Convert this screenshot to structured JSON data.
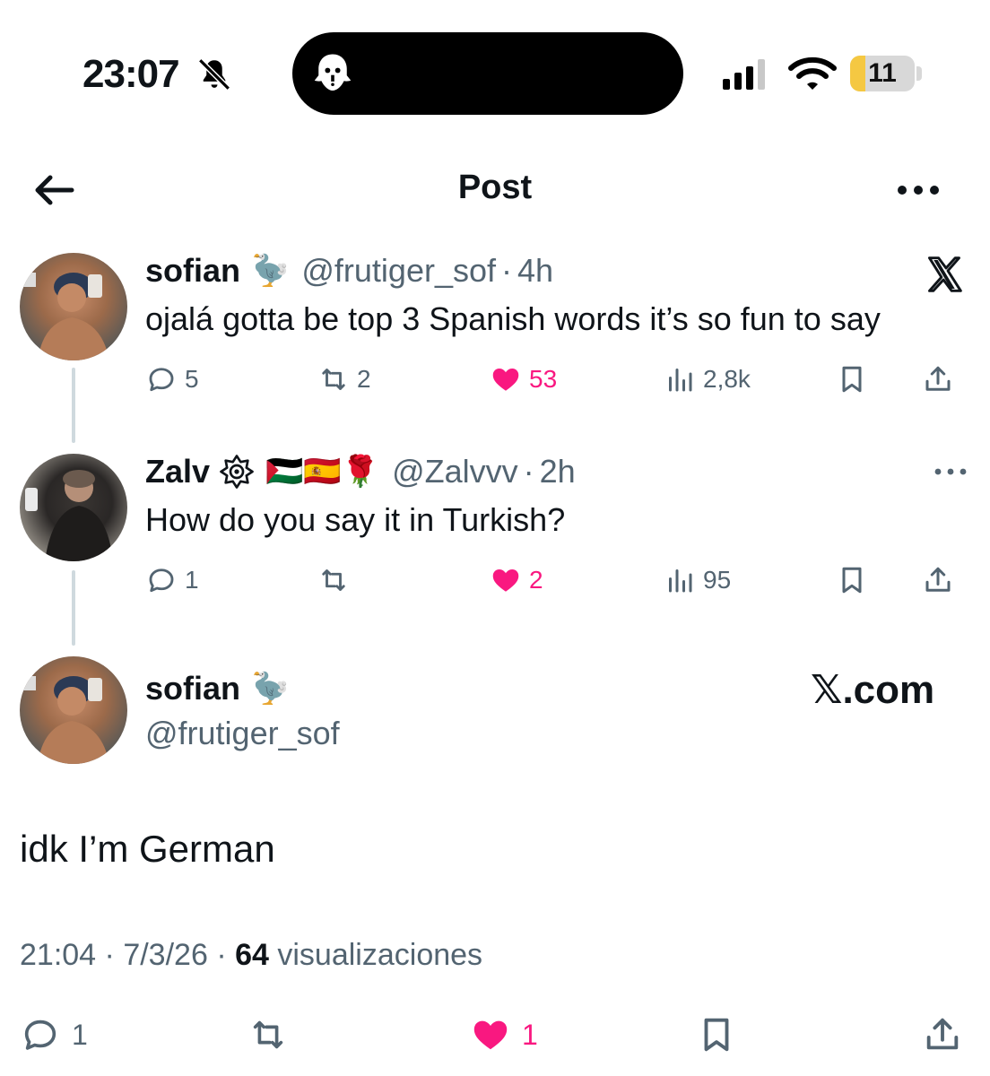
{
  "status_bar": {
    "time": "23:07",
    "battery_level": "11",
    "battery_fraction": 0.11
  },
  "header": {
    "title": "Post"
  },
  "colors": {
    "like": "#f91880",
    "secondary_text": "#536471",
    "primary_text": "#0f1419",
    "battery": "#f5c842"
  },
  "tweets": [
    {
      "name": "sofian",
      "emoji": "🦤",
      "handle": "@frutiger_sof",
      "sep": "·",
      "time": "4h",
      "text": "ojalá gotta be top 3 Spanish words it’s so fun to say",
      "replies": "5",
      "reposts": "2",
      "likes": "53",
      "views": "2,8k"
    },
    {
      "name": "Zalv",
      "emoji": "🇵🇸🇪🇸🌹",
      "handle": "@Zalvvv",
      "sep": "·",
      "time": "2h",
      "text": "How do you say it in Turkish?",
      "replies": "1",
      "reposts": "",
      "likes": "2",
      "views": "95"
    }
  ],
  "main_post": {
    "name": "sofian",
    "emoji": "🦤",
    "handle": "@frutiger_sof",
    "watermark": "𝕏.com",
    "text": "idk I’m German",
    "time": "21:04",
    "sep1": "·",
    "date": "7/3/26",
    "sep2": "·",
    "views_count": "64",
    "views_label": "visualizaciones",
    "replies": "1",
    "likes": "1"
  },
  "icons": {
    "back": "arrow-left-icon",
    "more": "ellipsis-icon",
    "x_logo": "x-logo-icon",
    "reply": "speech-bubble-icon",
    "repost": "repost-arrows-icon",
    "like": "heart-icon",
    "views": "bar-chart-icon",
    "bookmark": "bookmark-icon",
    "share": "share-upload-icon"
  }
}
